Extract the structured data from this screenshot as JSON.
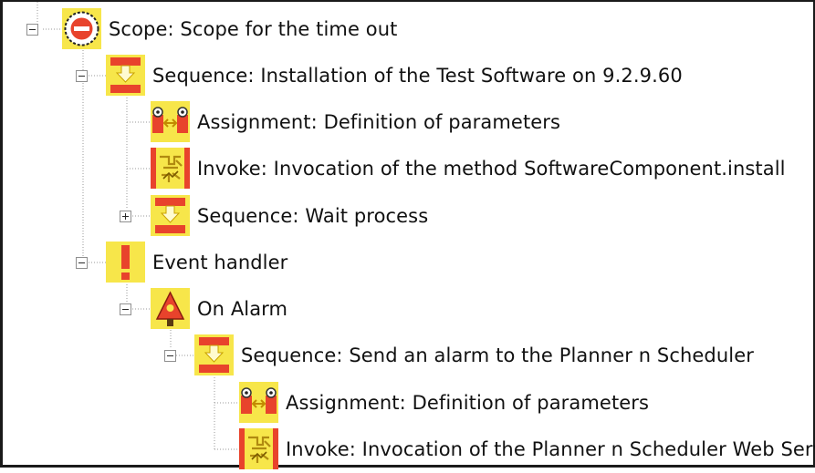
{
  "tree": {
    "scope_label": "Scope: Scope for the time out",
    "sequence_install_label": "Sequence: Installation of the Test Software on 9.2.9.60",
    "assignment_1_label": "Assignment: Definition of parameters",
    "invoke_install_label": "Invoke: Invocation of the method SoftwareComponent.install",
    "sequence_wait_label": "Sequence: Wait process",
    "event_handler_label": "Event handler",
    "on_alarm_label": "On Alarm",
    "sequence_alarm_label": "Sequence: Send an alarm to the Planner n Scheduler",
    "assignment_2_label": "Assignment: Definition of parameters",
    "invoke_webservice_label": "Invoke: Invocation of the Planner n Scheduler Web Service"
  },
  "icons": {
    "scope": "scope-icon",
    "sequence": "sequence-icon",
    "assignment": "assignment-icon",
    "invoke": "invoke-icon",
    "event_handler": "event-handler-icon",
    "on_alarm": "on-alarm-icon"
  },
  "colors": {
    "icon_yellow": "#f7e64a",
    "icon_red": "#e8432c",
    "tree_line": "#9a9a9a"
  }
}
